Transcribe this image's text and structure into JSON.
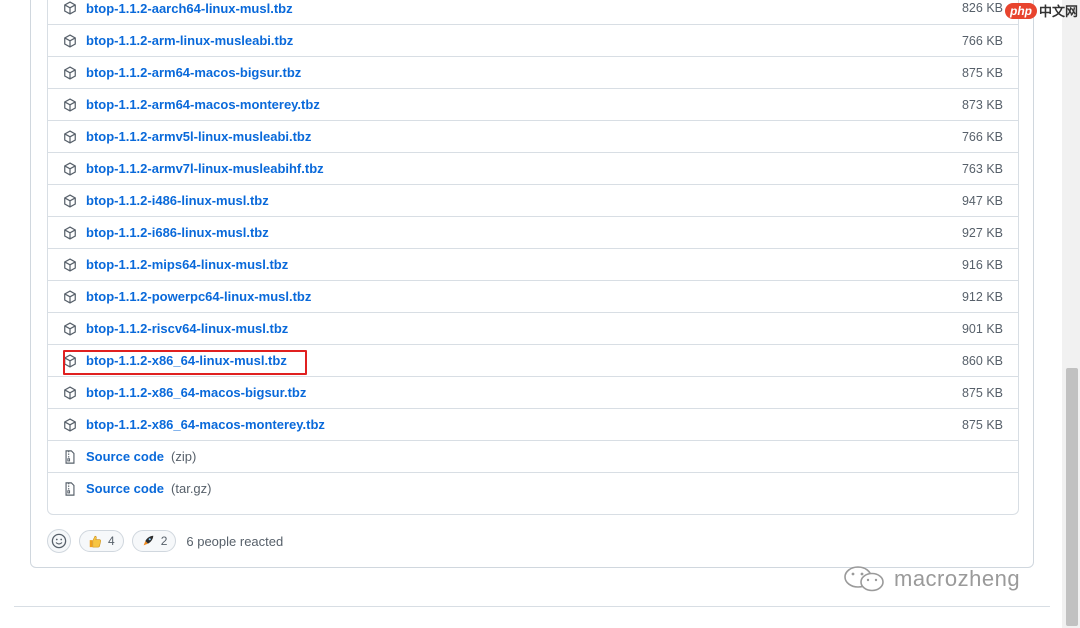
{
  "assets": [
    {
      "name": "btop-1.1.2-aarch64-linux-musl.tbz",
      "size": "826 KB",
      "icon": "package-icon"
    },
    {
      "name": "btop-1.1.2-arm-linux-musleabi.tbz",
      "size": "766 KB",
      "icon": "package-icon"
    },
    {
      "name": "btop-1.1.2-arm64-macos-bigsur.tbz",
      "size": "875 KB",
      "icon": "package-icon"
    },
    {
      "name": "btop-1.1.2-arm64-macos-monterey.tbz",
      "size": "873 KB",
      "icon": "package-icon"
    },
    {
      "name": "btop-1.1.2-armv5l-linux-musleabi.tbz",
      "size": "766 KB",
      "icon": "package-icon"
    },
    {
      "name": "btop-1.1.2-armv7l-linux-musleabihf.tbz",
      "size": "763 KB",
      "icon": "package-icon"
    },
    {
      "name": "btop-1.1.2-i486-linux-musl.tbz",
      "size": "947 KB",
      "icon": "package-icon"
    },
    {
      "name": "btop-1.1.2-i686-linux-musl.tbz",
      "size": "927 KB",
      "icon": "package-icon"
    },
    {
      "name": "btop-1.1.2-mips64-linux-musl.tbz",
      "size": "916 KB",
      "icon": "package-icon"
    },
    {
      "name": "btop-1.1.2-powerpc64-linux-musl.tbz",
      "size": "912 KB",
      "icon": "package-icon"
    },
    {
      "name": "btop-1.1.2-riscv64-linux-musl.tbz",
      "size": "901 KB",
      "icon": "package-icon"
    },
    {
      "name": "btop-1.1.2-x86_64-linux-musl.tbz",
      "size": "860 KB",
      "icon": "package-icon",
      "highlighted": true
    },
    {
      "name": "btop-1.1.2-x86_64-macos-bigsur.tbz",
      "size": "875 KB",
      "icon": "package-icon"
    },
    {
      "name": "btop-1.1.2-x86_64-macos-monterey.tbz",
      "size": "875 KB",
      "icon": "package-icon"
    }
  ],
  "source": [
    {
      "label": "Source code",
      "format": "(zip)",
      "icon": "file-zip-icon"
    },
    {
      "label": "Source code",
      "format": "(tar.gz)",
      "icon": "file-zip-icon"
    }
  ],
  "reactions": {
    "thumbs_up_count": "4",
    "rocket_count": "2",
    "summary": "6 people reacted"
  },
  "watermarks": {
    "top_badge": "php",
    "top_text": "中文网",
    "bottom_text": "macrozheng"
  },
  "colors": {
    "link": "#0969da",
    "muted": "#57606a",
    "border": "#d8dee4",
    "highlight": "#e02020"
  }
}
